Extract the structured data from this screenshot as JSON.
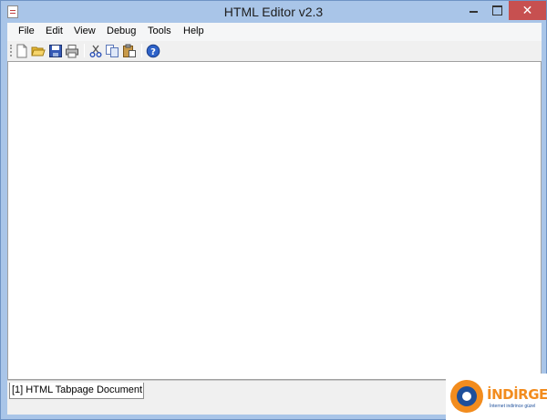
{
  "window": {
    "title": "HTML Editor v2.3",
    "close_glyph": "✕"
  },
  "menubar": {
    "items": [
      "File",
      "Edit",
      "View",
      "Debug",
      "Tools",
      "Help"
    ]
  },
  "toolbar": {
    "tools": [
      "new-icon",
      "open-icon",
      "save-icon",
      "print-icon",
      "cut-icon",
      "copy-icon",
      "paste-icon",
      "help-icon"
    ]
  },
  "editor": {
    "content": ""
  },
  "tabs": [
    {
      "label": "[1] HTML Tabpage Document",
      "active": true
    }
  ],
  "watermark": {
    "brand": "İNDİRGEN",
    "slogan": "İnternet indirince güzel"
  },
  "colors": {
    "titlebar": "#a9c5e8",
    "close": "#c75050",
    "brand_orange": "#f28c1e",
    "brand_blue": "#1e4f9a"
  }
}
